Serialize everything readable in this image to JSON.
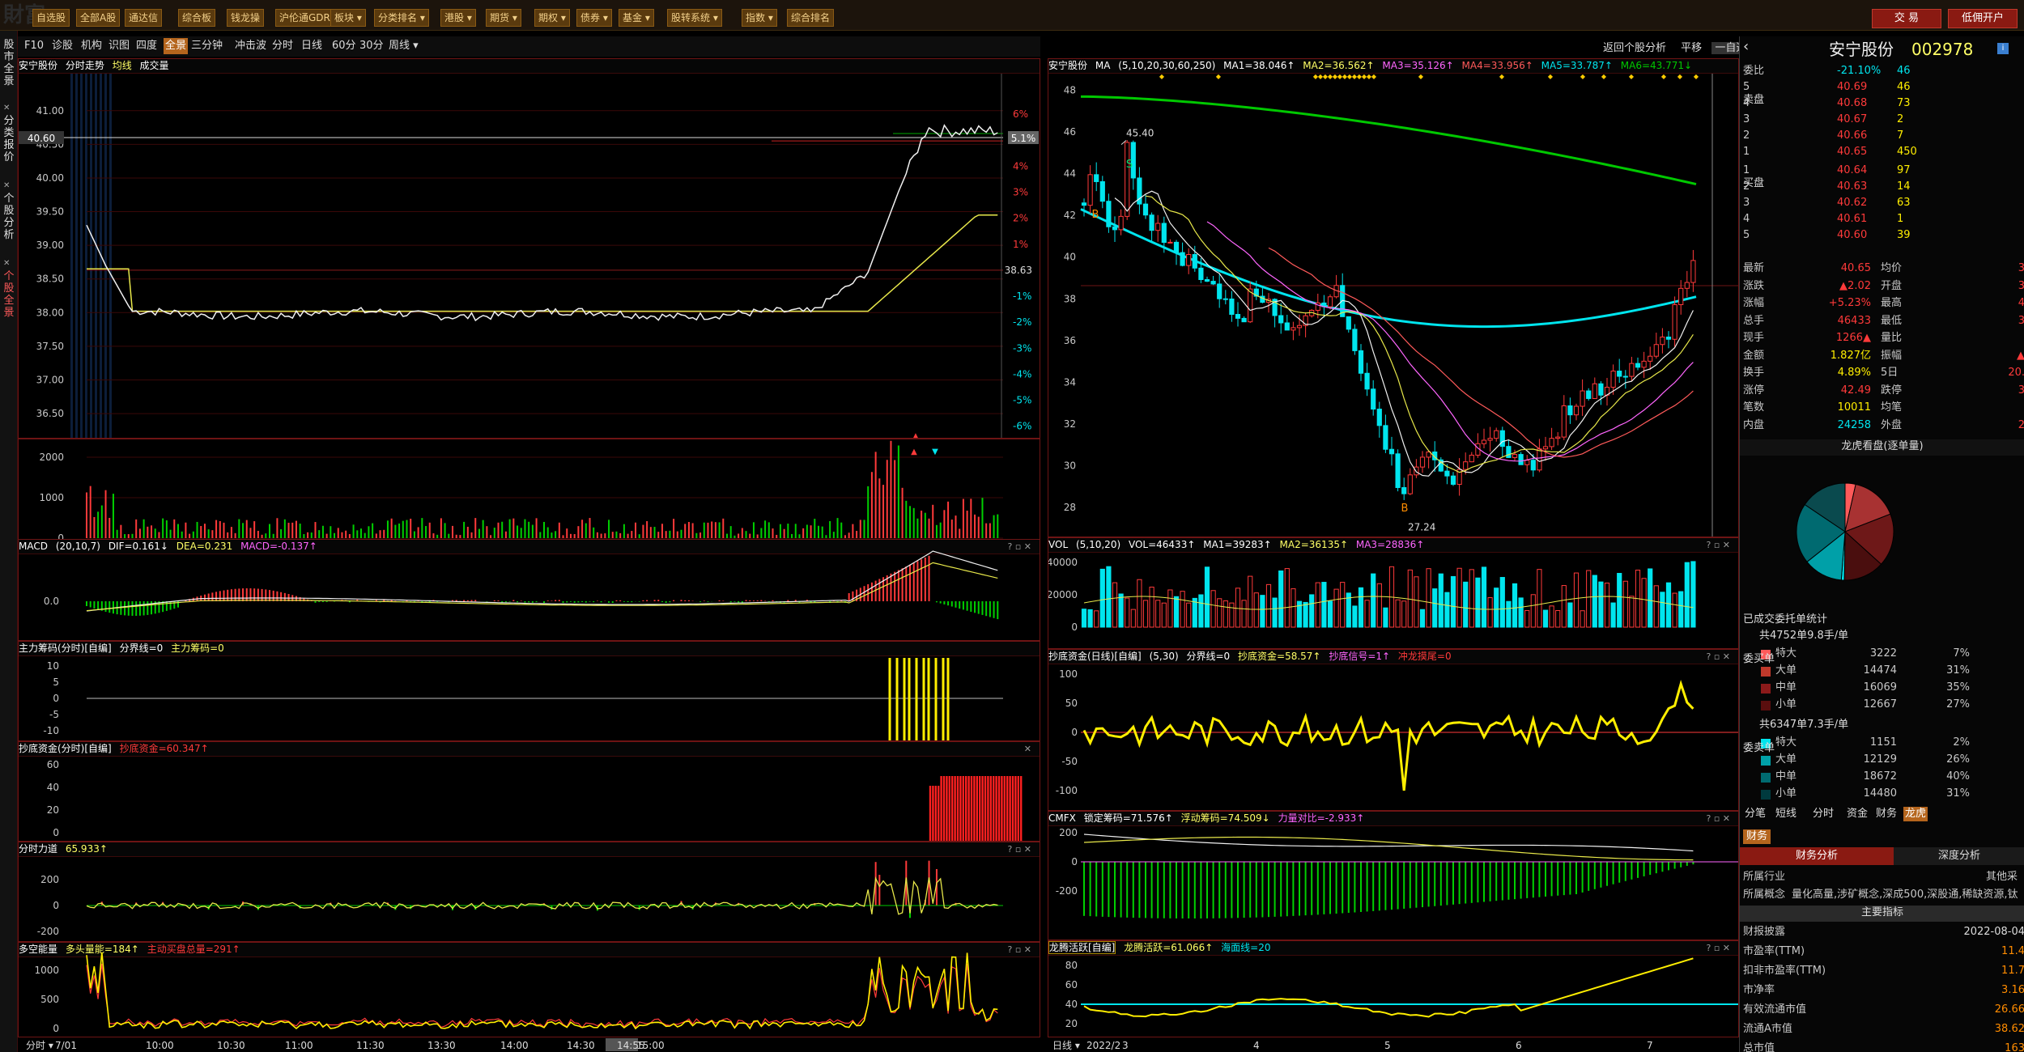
{
  "topbar": {
    "buttons": [
      "自选股",
      "全部A股",
      "通达信",
      "综合板",
      "钱龙操",
      "沪伦通GDR",
      "板块",
      "分类排名",
      "港股",
      "期货",
      "期权",
      "债券",
      "基金",
      "股转系统",
      "指数",
      "综合排名"
    ],
    "trade": "交 易",
    "open_account": "低佣开户"
  },
  "sidebar": [
    "股市全景",
    "分类报价",
    "个股分析",
    "个股全景"
  ],
  "tabs": [
    "F10",
    "诊股",
    "机构",
    "识图",
    "四度",
    "全景",
    "三分钟",
    "冲击波",
    "分时",
    "日线",
    "60分",
    "30分",
    "周线"
  ],
  "intraday": {
    "header": {
      "stock": "安宁股份",
      "mode": "分时走势",
      "avg": "均线",
      "vol": "成交量"
    },
    "price_labels": [
      "41.00",
      "40.50",
      "40.00",
      "39.50",
      "39.00",
      "38.50",
      "38.00",
      "37.50",
      "37.00",
      "36.50"
    ],
    "pct_labels": [
      "6%",
      "5%",
      "4%",
      "3%",
      "2%",
      "1%",
      "-1%",
      "-2%",
      "-3%",
      "-4%",
      "-5%",
      "-6%"
    ],
    "cur_price": "40.60",
    "cur_pct": "5.1%",
    "base_price": "38.63",
    "vol_labels": [
      "2000",
      "1000",
      "0"
    ],
    "time_labels": [
      "分时",
      "7/01",
      "10:00",
      "10:30",
      "11:00",
      "11:30",
      "13:30",
      "14:00",
      "14:30",
      "14:55",
      "15:00"
    ]
  },
  "ind_macd": {
    "title": "MACD",
    "params": "(20,10,7)",
    "dif": "DIF=0.161↓",
    "dea": "DEA=0.231",
    "macd": "MACD=-0.137↑",
    "labels": [
      "0.0"
    ]
  },
  "ind_main": {
    "title": "主力筹码(分时)[自编]",
    "a": "分界线=0",
    "b": "主力筹码=0",
    "labels": [
      "10",
      "5",
      "0",
      "-5",
      "-10"
    ]
  },
  "ind_bottom": {
    "title": "抄底资金(分时)[自编]",
    "a": "抄底资金=60.347↑",
    "labels": [
      "60",
      "40",
      "20",
      "0"
    ]
  },
  "ind_force": {
    "title": "分时力道",
    "a": "65.933↑",
    "labels": [
      "200",
      "0",
      "-200"
    ]
  },
  "ind_energy": {
    "title": "多空能量",
    "a": "多头量能=184↑",
    "b": "主动买盘总量=291↑",
    "labels": [
      "1000",
      "500",
      "0"
    ]
  },
  "daily": {
    "header": {
      "stock": "安宁股份",
      "ma": "MA",
      "params": "(5,10,20,30,60,250)",
      "ma1": "MA1=38.046↑",
      "ma2": "MA2=36.562↑",
      "ma3": "MA3=35.126↑",
      "ma4": "MA4=33.956↑",
      "ma5": "MA5=33.787↑",
      "ma6": "MA6=43.771↓"
    },
    "toolbar": {
      "analysis": "返回个股分析",
      "flat": "平移",
      "select": "一自选"
    },
    "y_labels": [
      "48",
      "46",
      "44",
      "42",
      "40",
      "38",
      "36",
      "34",
      "32",
      "30",
      "28"
    ],
    "high_mark": "45.40",
    "low_mark": "27.24",
    "date_labels": [
      "日线",
      "2022/2",
      "3",
      "4",
      "5",
      "6",
      "7"
    ]
  },
  "vol_panel": {
    "title": "VOL",
    "params": "(5,10,20)",
    "vol": "VOL=46433↑",
    "ma1": "MA1=39283↑",
    "ma2": "MA2=36135↑",
    "ma3": "MA3=28836↑",
    "labels": [
      "40000",
      "20000",
      "0"
    ]
  },
  "bottomfund": {
    "title": "抄底资金(日线)[自编]",
    "params": "(5,30)",
    "a": "分界线=0",
    "b": "抄底资金=58.57↑",
    "c": "抄底信号=1↑",
    "d": "冲龙摸尾=0",
    "labels": [
      "100",
      "50",
      "0",
      "-50",
      "-100"
    ]
  },
  "cmfx": {
    "title": "CMFX",
    "a": "锁定筹码=71.576↑",
    "b": "浮动筹码=74.509↓",
    "c": "力量对比=-2.933↑",
    "labels": [
      "200",
      "0",
      "-200"
    ]
  },
  "dragon": {
    "title": "龙腾活跃[自编]",
    "a": "龙腾活跃=61.066↑",
    "b": "海面线=20",
    "labels": [
      "80",
      "60",
      "40",
      "20"
    ]
  },
  "quote": {
    "name": "安宁股份",
    "code": "002978",
    "weibi_label": "委比",
    "weibi": "-21.10%",
    "weicha": "46",
    "sell": [
      {
        "label": "5",
        "price": "40.69",
        "vol": "46"
      },
      {
        "label": "4",
        "price": "40.68",
        "vol": "73"
      },
      {
        "label": "3",
        "price": "40.67",
        "vol": "2"
      },
      {
        "label": "2",
        "price": "40.66",
        "vol": "7"
      },
      {
        "label": "1",
        "price": "40.65",
        "vol": "450"
      }
    ],
    "buy": [
      {
        "label": "1",
        "price": "40.64",
        "vol": "97"
      },
      {
        "label": "2",
        "price": "40.63",
        "vol": "14"
      },
      {
        "label": "3",
        "price": "40.62",
        "vol": "63"
      },
      {
        "label": "4",
        "price": "40.61",
        "vol": "1"
      },
      {
        "label": "5",
        "price": "40.60",
        "vol": "39"
      }
    ],
    "sell_side": "卖盘",
    "buy_side": "买盘",
    "stats_left": [
      {
        "k": "最新",
        "v": "40.65"
      },
      {
        "k": "涨跌",
        "v": "▲2.02"
      },
      {
        "k": "涨幅",
        "v": "+5.23%"
      },
      {
        "k": "总手",
        "v": "46433"
      },
      {
        "k": "现手",
        "v": "1266▲"
      },
      {
        "k": "金额",
        "v": "1.827亿"
      },
      {
        "k": "换手",
        "v": "4.89%"
      },
      {
        "k": "涨停",
        "v": "42.49"
      },
      {
        "k": "笔数",
        "v": "10011"
      },
      {
        "k": "内盘",
        "v": "24258"
      }
    ],
    "stats_right": [
      {
        "k": "均价",
        "v": "3"
      },
      {
        "k": "开盘",
        "v": "3"
      },
      {
        "k": "最高",
        "v": "4"
      },
      {
        "k": "最低",
        "v": "3"
      },
      {
        "k": "量比",
        "v": ""
      },
      {
        "k": "振幅",
        "v": "▲"
      },
      {
        "k": "5日",
        "v": "20."
      },
      {
        "k": "跌停",
        "v": "3"
      },
      {
        "k": "均笔",
        "v": ""
      },
      {
        "k": "外盘",
        "v": "2"
      }
    ],
    "pie_title": "龙虎看盘(逐单量)",
    "order_stat": "已成交委托单统计",
    "buy_total": "共4752单9.8手/单",
    "sell_total": "共6347单7.3手/单",
    "buy_side_lbl": "委买单",
    "sell_side_lbl": "委卖单",
    "buy_rows": [
      {
        "k": "特大",
        "v": "3222",
        "p": "7%"
      },
      {
        "k": "大单",
        "v": "14474",
        "p": "31%"
      },
      {
        "k": "中单",
        "v": "16069",
        "p": "35%"
      },
      {
        "k": "小单",
        "v": "12667",
        "p": "27%"
      }
    ],
    "sell_rows": [
      {
        "k": "特大",
        "v": "1151",
        "p": "2%"
      },
      {
        "k": "大单",
        "v": "12129",
        "p": "26%"
      },
      {
        "k": "中单",
        "v": "18672",
        "p": "40%"
      },
      {
        "k": "小单",
        "v": "14480",
        "p": "31%"
      }
    ],
    "tabs": [
      "分笔",
      "短线",
      "分时",
      "资金",
      "财务",
      "龙虎"
    ],
    "fin_tab": "财务",
    "fin_a": "财务分析",
    "fin_b": "深度分析",
    "industry_k": "所属行业",
    "industry_v": "其他采",
    "concept_k": "所属概念",
    "concept_v": "量化高量,涉矿概念,深成500,深股通,稀缺资源,钛",
    "indicator": "主要指标",
    "fin_rows": [
      {
        "k": "财报披露",
        "v": "2022-08-04"
      },
      {
        "k": "市盈率(TTM)",
        "v": "11.4"
      },
      {
        "k": "扣非市盈率(TTM)",
        "v": "11.7"
      },
      {
        "k": "市净率",
        "v": "3.16"
      },
      {
        "k": "有效流通市值",
        "v": "26.66"
      },
      {
        "k": "流通A市值",
        "v": "38.62"
      },
      {
        "k": "总市值",
        "v": "163"
      }
    ]
  },
  "colors": {
    "up": "#ff3a3a",
    "down": "#00e5ee",
    "frame": "#6e1414",
    "ma250": "#00c800"
  }
}
